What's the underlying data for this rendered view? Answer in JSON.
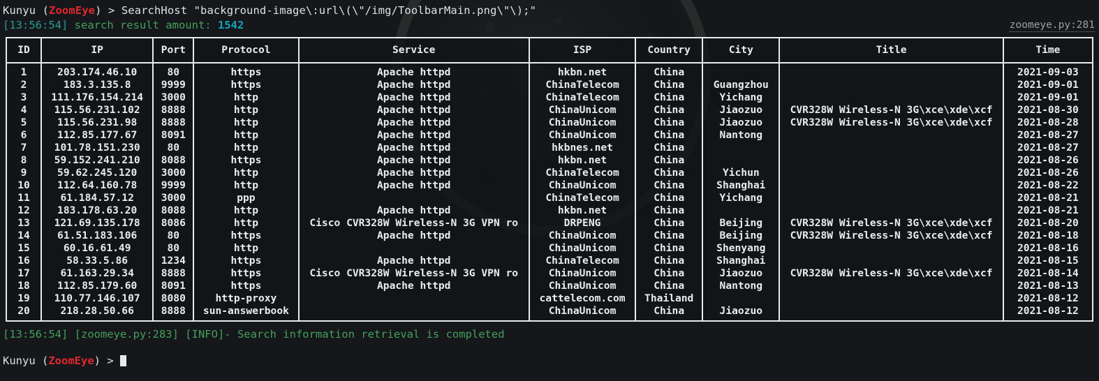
{
  "prompt": {
    "user": "Kunyu",
    "open_paren": " (",
    "app": "ZoomEye",
    "close_paren": ") ",
    "symbol": "> "
  },
  "command_line": {
    "command": "SearchHost \"background-image\\:url\\(\\\"/img/ToolbarMain.png\\\"\\);\""
  },
  "result_line": {
    "timestamp": "[13:56:54] ",
    "label": "search result amount: ",
    "amount": "1542"
  },
  "source_ref": "zoomeye.py:281",
  "table": {
    "headers": [
      "ID",
      "IP",
      "Port",
      "Protocol",
      "Service",
      "ISP",
      "Country",
      "City",
      "Title",
      "Time"
    ],
    "rows": [
      [
        "1",
        "203.174.46.10",
        "80",
        "https",
        "Apache httpd",
        "hkbn.net",
        "China",
        "",
        "",
        "2021-09-03"
      ],
      [
        "2",
        "183.3.135.8",
        "9999",
        "https",
        "Apache httpd",
        "ChinaTelecom",
        "China",
        "Guangzhou",
        "",
        "2021-09-01"
      ],
      [
        "3",
        "111.176.154.214",
        "3000",
        "http",
        "Apache httpd",
        "ChinaTelecom",
        "China",
        "Yichang",
        "",
        "2021-09-01"
      ],
      [
        "4",
        "115.56.231.102",
        "8888",
        "http",
        "Apache httpd",
        "ChinaUnicom",
        "China",
        "Jiaozuo",
        "CVR328W Wireless-N 3G\\xce\\xde\\xcf",
        "2021-08-30"
      ],
      [
        "5",
        "115.56.231.98",
        "8888",
        "http",
        "Apache httpd",
        "ChinaUnicom",
        "China",
        "Jiaozuo",
        "CVR328W Wireless-N 3G\\xce\\xde\\xcf",
        "2021-08-28"
      ],
      [
        "6",
        "112.85.177.67",
        "8091",
        "http",
        "Apache httpd",
        "ChinaUnicom",
        "China",
        "Nantong",
        "",
        "2021-08-27"
      ],
      [
        "7",
        "101.78.151.230",
        "80",
        "http",
        "Apache httpd",
        "hkbnes.net",
        "China",
        "",
        "",
        "2021-08-27"
      ],
      [
        "8",
        "59.152.241.210",
        "8088",
        "https",
        "Apache httpd",
        "hkbn.net",
        "China",
        "",
        "",
        "2021-08-26"
      ],
      [
        "9",
        "59.62.245.120",
        "3000",
        "http",
        "Apache httpd",
        "ChinaTelecom",
        "China",
        "Yichun",
        "",
        "2021-08-26"
      ],
      [
        "10",
        "112.64.160.78",
        "9999",
        "http",
        "Apache httpd",
        "ChinaUnicom",
        "China",
        "Shanghai",
        "",
        "2021-08-22"
      ],
      [
        "11",
        "61.184.57.12",
        "3000",
        "ppp",
        "",
        "ChinaTelecom",
        "China",
        "Yichang",
        "",
        "2021-08-21"
      ],
      [
        "12",
        "183.178.63.20",
        "8088",
        "http",
        "Apache httpd",
        "hkbn.net",
        "China",
        "",
        "",
        "2021-08-21"
      ],
      [
        "13",
        "121.69.135.178",
        "8086",
        "http",
        "Cisco CVR328W Wireless-N 3G VPN ro",
        "DRPENG",
        "China",
        "Beijing",
        "CVR328W Wireless-N 3G\\xce\\xde\\xcf",
        "2021-08-20"
      ],
      [
        "14",
        "61.51.183.106",
        "80",
        "https",
        "Apache httpd",
        "ChinaUnicom",
        "China",
        "Beijing",
        "CVR328W Wireless-N 3G\\xce\\xde\\xcf",
        "2021-08-18"
      ],
      [
        "15",
        "60.16.61.49",
        "80",
        "http",
        "",
        "ChinaUnicom",
        "China",
        "Shenyang",
        "",
        "2021-08-16"
      ],
      [
        "16",
        "58.33.5.86",
        "1234",
        "https",
        "Apache httpd",
        "ChinaTelecom",
        "China",
        "Shanghai",
        "",
        "2021-08-15"
      ],
      [
        "17",
        "61.163.29.34",
        "8888",
        "https",
        "Cisco CVR328W Wireless-N 3G VPN ro",
        "ChinaUnicom",
        "China",
        "Jiaozuo",
        "CVR328W Wireless-N 3G\\xce\\xde\\xcf",
        "2021-08-14"
      ],
      [
        "18",
        "112.85.179.60",
        "8091",
        "https",
        "Apache httpd",
        "ChinaUnicom",
        "China",
        "Nantong",
        "",
        "2021-08-13"
      ],
      [
        "19",
        "110.77.146.107",
        "8080",
        "http-proxy",
        "",
        "cattelecom.com",
        "Thailand",
        "",
        "",
        "2021-08-12"
      ],
      [
        "20",
        "218.28.50.66",
        "8888",
        "sun-answerbook",
        "",
        "ChinaUnicom",
        "China",
        "Jiaozuo",
        "",
        "2021-08-12"
      ]
    ]
  },
  "footer_log": {
    "timestamp": "[13:56:54] ",
    "source": "[zoomeye.py:283] ",
    "level": "[INFO]- ",
    "message": "Search information retrieval is completed"
  },
  "colors": {
    "background": "#15171b",
    "foreground": "#d8dadd",
    "app_accent": "#e0282d",
    "green": "#45a05a",
    "teal": "#2a9d8f",
    "cyan": "#13a3b5",
    "border": "#e8eaec"
  }
}
